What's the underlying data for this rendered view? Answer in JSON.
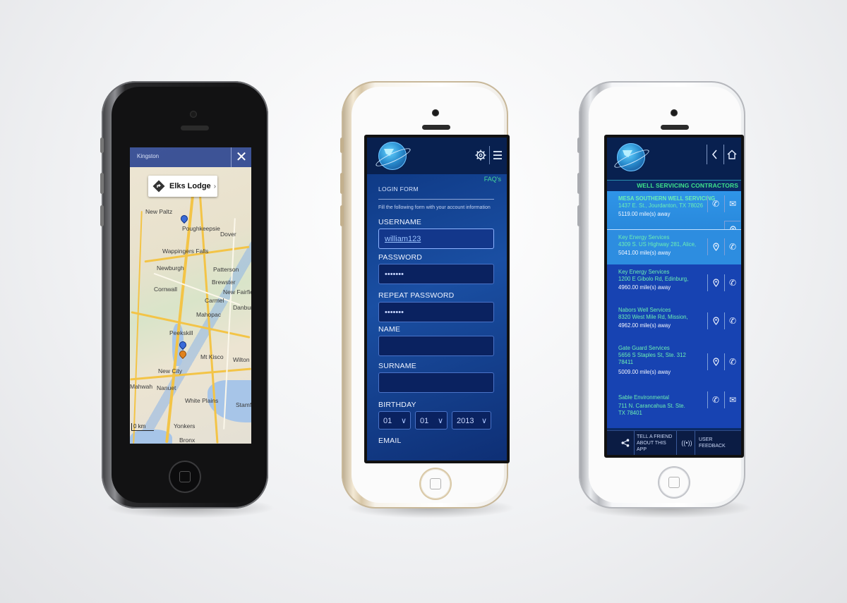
{
  "map_screen": {
    "callout_label": "Elks Lodge",
    "callout_chevron": "›",
    "close_label": "✕",
    "top_label": "Kingston",
    "scale_label": "0 km",
    "towns": [
      "New Paltz",
      "Poughkeepsie",
      "Dover",
      "Wappingers Falls",
      "Newburgh",
      "Patterson",
      "Brewster",
      "Cornwall",
      "New Fairfield",
      "Carmel",
      "Danbury",
      "Mahopac",
      "Peekskill",
      "Mt Kisco",
      "Wilton",
      "New City",
      "Mahwah",
      "Nanuet",
      "White Plains",
      "Stamford",
      "Yonkers",
      "Bronx"
    ]
  },
  "login_screen": {
    "faqs": "FAQ's",
    "form_title": "LOGIN FORM",
    "form_sub": "Fill the following form with your account information",
    "username_label": "USERNAME",
    "username_value": "william123",
    "password_label": "PASSWORD",
    "password_value": "•••••••",
    "repeat_label": "REPEAT PASSWORD",
    "repeat_value": "•••••••",
    "name_label": "NAME",
    "surname_label": "SURNAME",
    "birthday_label": "BIRTHDAY",
    "birth_day": "01",
    "birth_month": "01",
    "birth_year": "2013",
    "email_label": "EMAIL",
    "settings_icon": "gear-icon",
    "menu_icon": "hamburger-icon"
  },
  "list_screen": {
    "section_title": "WELL SERVICING CONTRACTORS",
    "back_icon": "chevron-left-icon",
    "home_icon": "home-icon",
    "rows": [
      {
        "name": "MESA SOUTHERN WELL SERVICING",
        "address": "1437 E. St., Jourdanton, TX 78026",
        "address2": "",
        "distance": "5119.00 mile(s) away"
      },
      {
        "name": "Key Energy Services",
        "address": "4309 S. US Highway 281, Alice,",
        "address2": "",
        "distance": "5041.00 mile(s) away"
      },
      {
        "name": "Key Energy Services",
        "address": "1200 E Gibolo Rd, Edinburg,",
        "address2": "",
        "distance": "4960.00 mile(s) away"
      },
      {
        "name": "Nabors Well Services",
        "address": "8320 West Mile Rd, Mission,",
        "address2": "",
        "distance": "4962.00 mile(s) away"
      },
      {
        "name": "Gate Guard Services",
        "address": "5656 S Staples St, Ste. 312",
        "address2": "78411",
        "distance": "5009.00 mile(s) away"
      },
      {
        "name": "Sable Environmental",
        "address": "711 N. Carancahua St. Ste.",
        "address2": "TX 78401",
        "distance": ""
      }
    ],
    "footer": {
      "share_icon": "share-icon",
      "tell_friend": "TELL A FRIEND ABOUT THIS APP",
      "signal_icon": "broadcast-icon",
      "feedback": "USER FEEDBACK"
    }
  },
  "colors": {
    "accent_green": "#3fe38a",
    "app_navy": "#08204f",
    "row_highlight": "#2d8de0",
    "form_blue": "#1a4fa3"
  }
}
